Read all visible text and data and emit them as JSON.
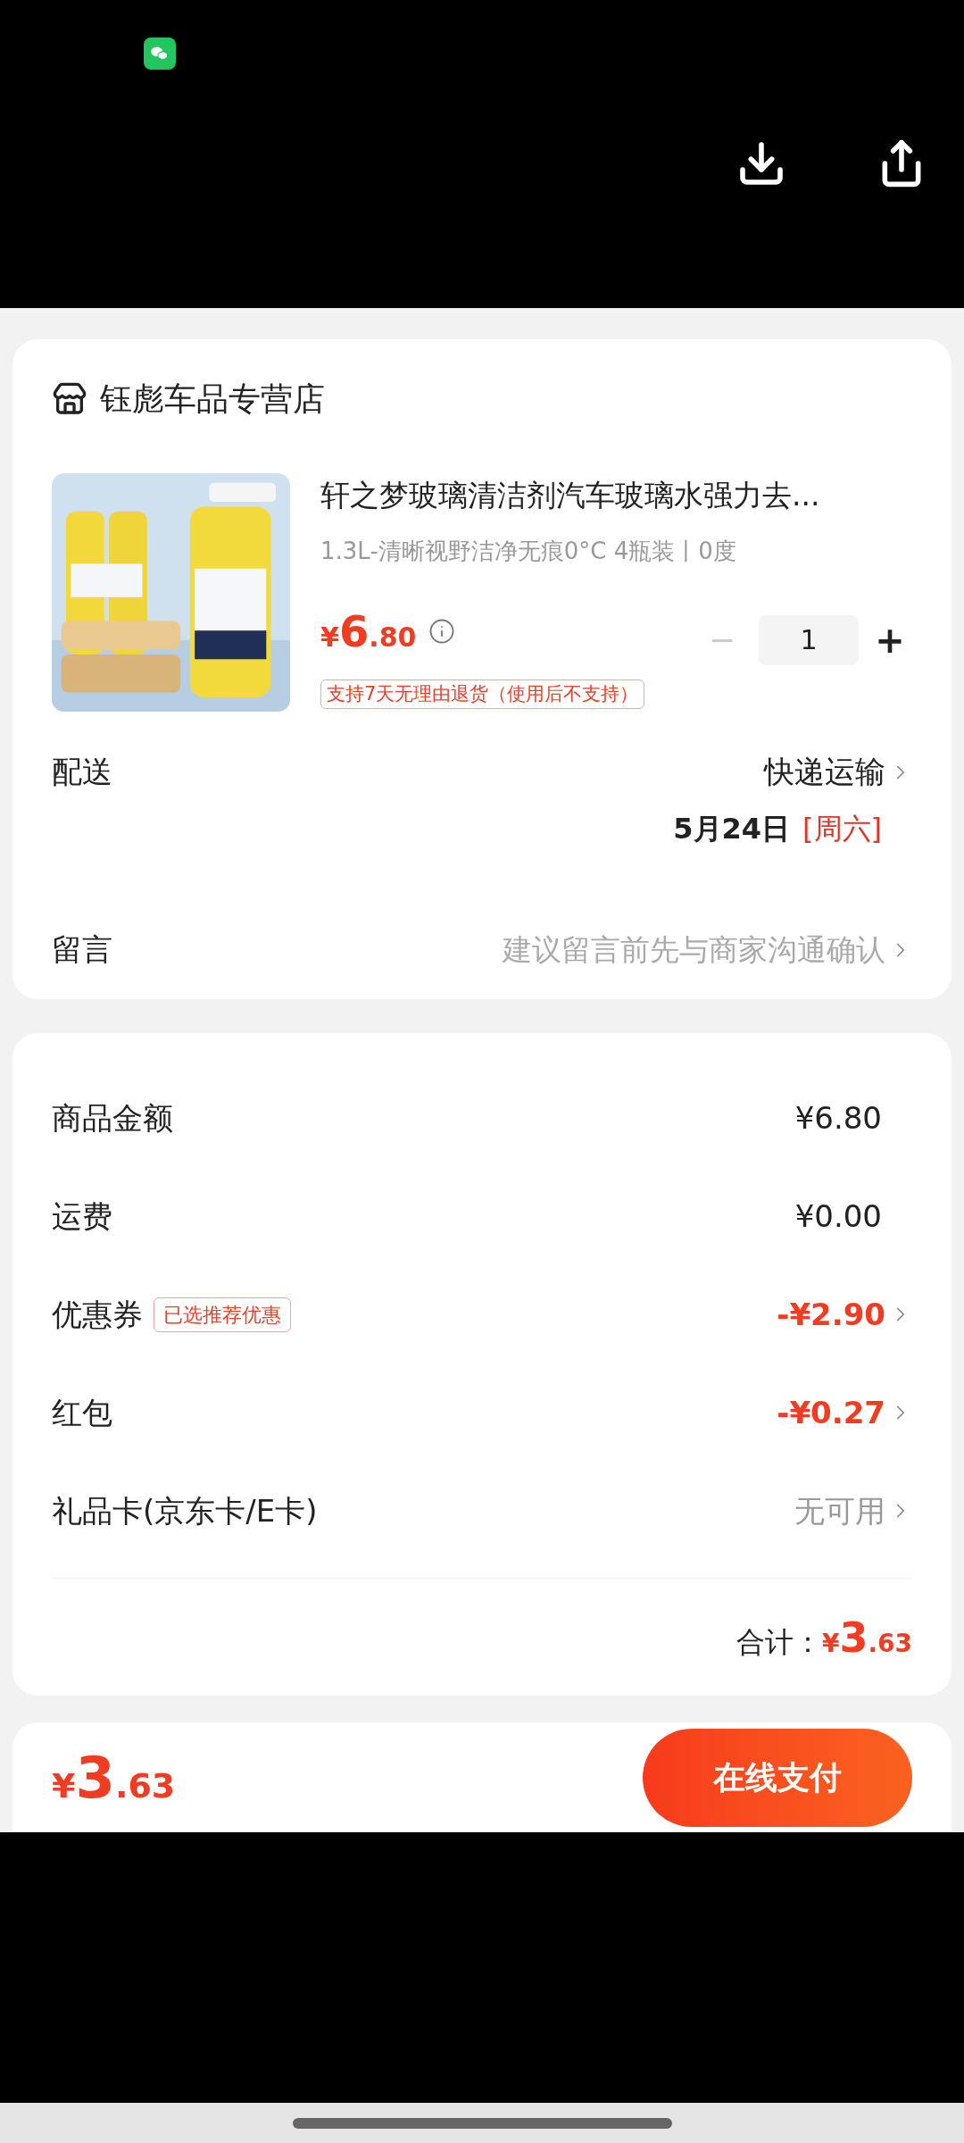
{
  "store": {
    "name": "钰彪车品专营店"
  },
  "product": {
    "title": "轩之梦玻璃清洁剂汽车玻璃水强力去...",
    "spec": "1.3L-清晰视野洁净无痕0°C 4瓶装丨0度",
    "price": {
      "currency": "¥",
      "integer": "6",
      "decimal": ".80"
    },
    "quantity": {
      "minus": "−",
      "value": "1",
      "plus": "+",
      "minus_disabled": true
    },
    "return_tag": "支持7天无理由退货（使用后不支持）"
  },
  "delivery": {
    "label": "配送",
    "method": "快递运输",
    "date": "5月24日",
    "weekday": "[周六]"
  },
  "message": {
    "label": "留言",
    "placeholder": "建议留言前先与商家沟通确认"
  },
  "fees": [
    {
      "label": "商品金额",
      "value": "¥6.80",
      "kind": "normal",
      "arrow": false
    },
    {
      "label": "运费",
      "value": "¥0.00",
      "kind": "normal",
      "arrow": false
    },
    {
      "label": "优惠券",
      "tag": "已选推荐优惠",
      "value": "-¥2.90",
      "kind": "discount",
      "arrow": true
    },
    {
      "label": "红包",
      "value": "-¥0.27",
      "kind": "discount",
      "arrow": true
    },
    {
      "label": "礼品卡(京东卡/E卡)",
      "value": "无可用",
      "kind": "muted",
      "arrow": true
    }
  ],
  "total": {
    "label": "合计：",
    "currency": "¥",
    "integer": "3",
    "decimal": ".63"
  },
  "footer": {
    "currency": "¥",
    "integer": "3",
    "decimal": ".63",
    "pay_button": "在线支付"
  }
}
